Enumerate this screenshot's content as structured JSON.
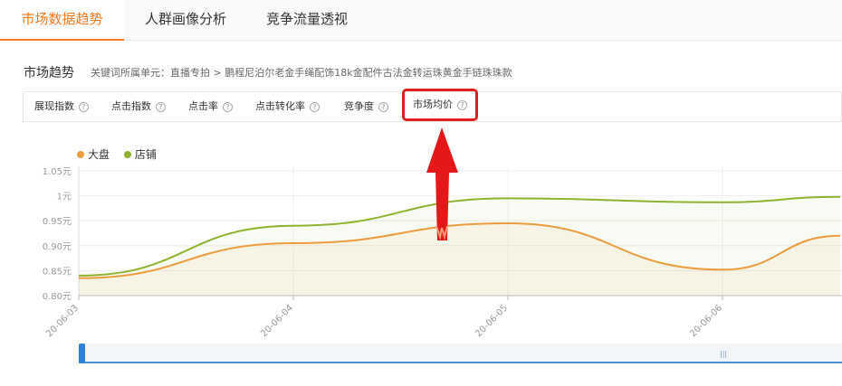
{
  "tabs": [
    {
      "label": "市场数据趋势",
      "active": true
    },
    {
      "label": "人群画像分析",
      "active": false
    },
    {
      "label": "竞争流量透视",
      "active": false
    }
  ],
  "section_title": "市场趋势",
  "keyword_path": "关键词所属单元：直播专拍 > 鹏程尼泊尔老金手绳配饰18k金配件古法金转运珠黄金手链珠珠款",
  "metrics": [
    "展现指数",
    "点击指数",
    "点击率",
    "点击转化率",
    "竞争度",
    "市场均价"
  ],
  "selected_metric": "市场均价",
  "help_icon": "?",
  "legend": [
    {
      "name": "大盘",
      "color": "#f39b3f"
    },
    {
      "name": "店铺",
      "color": "#8fb32f"
    }
  ],
  "chart_data": {
    "type": "line",
    "x": [
      "20-06-03",
      "20-06-04",
      "20-06-05",
      "20-06-06"
    ],
    "y_ticks": [
      "1.05元",
      "1元",
      "0.95元",
      "0.90元",
      "0.85元",
      "0.80元"
    ],
    "ylim": [
      0.8,
      1.05
    ],
    "series": [
      {
        "name": "大盘",
        "color": "#f39b3f",
        "points": [
          [
            0,
            0.835
          ],
          [
            1,
            0.905
          ],
          [
            2,
            0.945
          ],
          [
            3,
            0.852
          ],
          [
            3.55,
            0.92
          ]
        ]
      },
      {
        "name": "店铺",
        "color": "#8fb32f",
        "points": [
          [
            0,
            0.84
          ],
          [
            1,
            0.94
          ],
          [
            2,
            0.995
          ],
          [
            3,
            0.987
          ],
          [
            3.55,
            0.998
          ]
        ]
      }
    ],
    "grid": true
  },
  "annotation": {
    "type": "arrow",
    "color": "#e41818",
    "target": "市场均价"
  },
  "zoom_grip": "|||"
}
